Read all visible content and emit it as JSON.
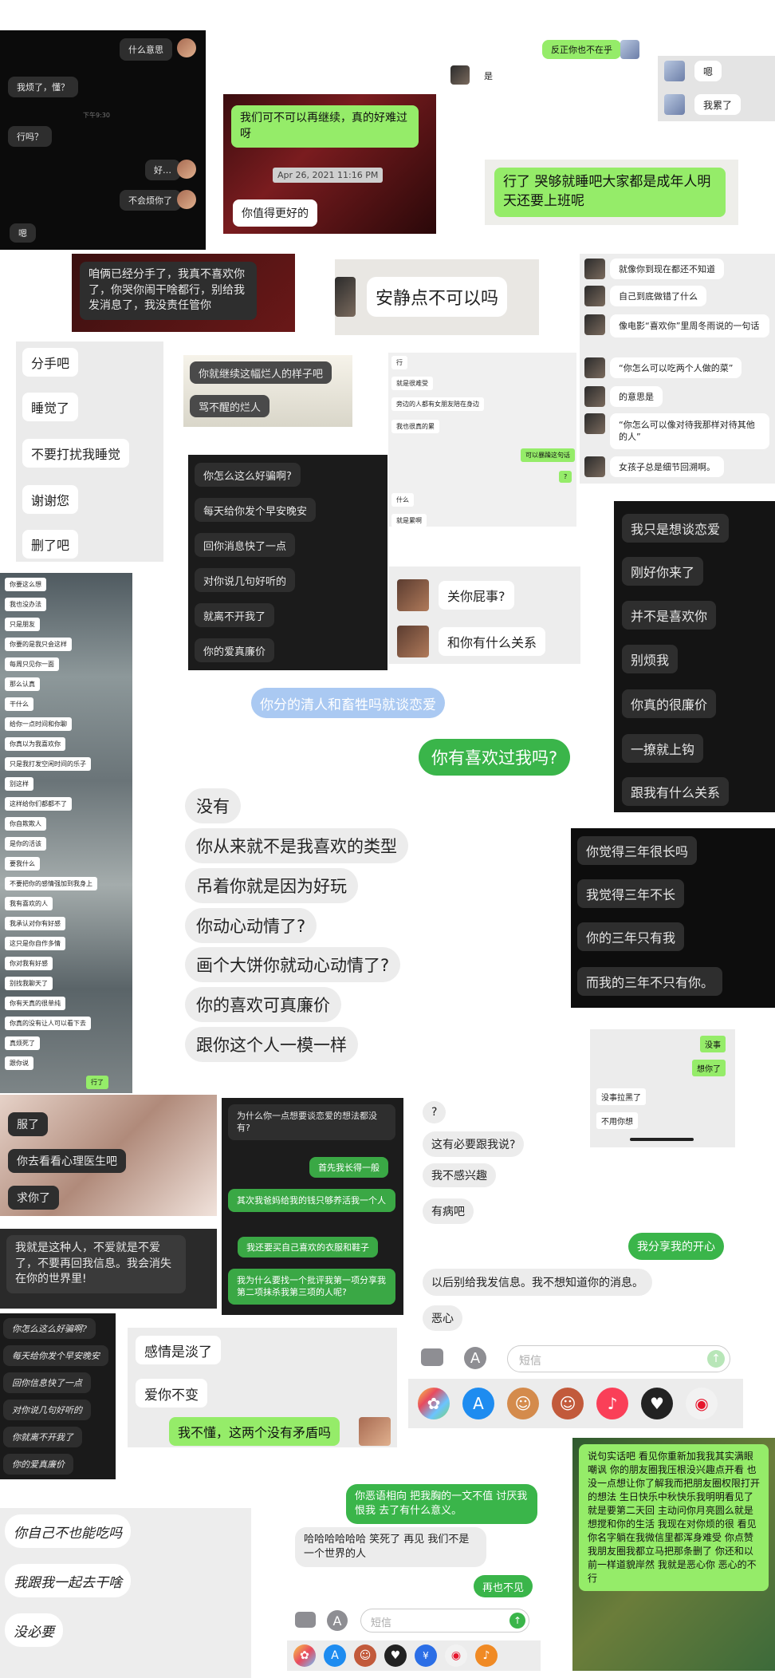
{
  "c1": {
    "b1": "什么意思",
    "b2": "我烦了，懂？",
    "time": "下午9:30",
    "b3": "行吗？",
    "b4": "好…",
    "b5": "不会烦你了",
    "b6": "嗯"
  },
  "c2": {
    "b1": "我们可不可以再继续，真的好难过呀",
    "date": "Apr 26, 2021 11:16 PM",
    "b2": "你值得更好的"
  },
  "c3": {
    "b1": "反正你也不在乎",
    "b2": "是"
  },
  "c4": {
    "b1": "嗯",
    "b2": "我累了"
  },
  "c5": {
    "b1": "行了 哭够就睡吧大家都是成年人明天还要上班呢"
  },
  "c6": {
    "b1": "咱俩已经分手了，我真不喜欢你了，你哭你闹干啥都行，别给我发消息了，我没责任管你"
  },
  "c7": {
    "b1": "安静点不可以吗"
  },
  "c8": {
    "items": [
      "就像你到现在都还不知道",
      "自己到底做错了什么",
      "像电影“喜欢你”里周冬雨说的一句话",
      "“你怎么可以吃两个人做的菜”",
      "的意思是",
      "“你怎么可以像对待我那样对待其他的人”",
      "女孩子总是细节回溯啊。"
    ]
  },
  "c9": {
    "items": [
      "分手吧",
      "睡觉了",
      "不要打扰我睡觉",
      "谢谢您",
      "删了吧"
    ]
  },
  "c10": {
    "b1": "你就继续这幅烂人的样子吧",
    "b2": "骂不醒的烂人"
  },
  "c11": {
    "b1": "行",
    "b2": "就是很难受",
    "b3": "旁边的人都有女朋友陪在身边",
    "b4": "我也很真的累",
    "b5": "可以暴躁这句话",
    "b6": "?",
    "b7": "什么",
    "b8": "就是累啊"
  },
  "c12": {
    "items": [
      "你怎么这么好骗啊?",
      "每天给你发个早安晚安",
      "回你消息快了一点",
      "对你说几句好听的",
      "就离不开我了",
      "你的爱真廉价"
    ]
  },
  "c13": {
    "b1": "关你屁事?",
    "b2": "和你有什么关系"
  },
  "c14": {
    "items": [
      "我只是想谈恋爱",
      "刚好你来了",
      "并不是喜欢你",
      "别烦我",
      "你真的很廉价",
      "一撩就上钩",
      "跟我有什么关系"
    ]
  },
  "c15": {
    "items": [
      "你要这么想",
      "我也没办法",
      "只是朋友",
      "你要的是我只会这样",
      "每周只见你一面",
      "那么认真",
      "干什么",
      "给你一点时间和你聊",
      "你真以为我喜欢你",
      "只是我打发空闲时间的乐子",
      "别这样",
      "这样给你们都都不了",
      "你自欺欺人",
      "是你的活该",
      "要我什么",
      "不要把你的感情强加到我身上",
      "我有喜欢的人",
      "我承认对你有好感",
      "这只是你自作多情",
      "你对我有好感",
      "别找我聊天了",
      "你有天真的很单纯",
      "你真的没有让人可以看下去",
      "真烦死了",
      "跟你说"
    ],
    "last": "行了"
  },
  "c16": {
    "b1": "你分的清人和畜牲吗就谈恋爱"
  },
  "c17": {
    "b1": "你有喜欢过我吗?"
  },
  "c18": {
    "items": [
      "没有",
      "你从来就不是我喜欢的类型",
      "吊着你就是因为好玩",
      "你动心动情了?",
      "画个大饼你就动心动情了?",
      "你的喜欢可真廉价",
      "跟你这个人一模一样"
    ]
  },
  "c19": {
    "items": [
      "你觉得三年很长吗",
      "我觉得三年不长",
      "你的三年只有我",
      "而我的三年不只有你。"
    ]
  },
  "c20": {
    "b1": "没事",
    "b2": "想你了",
    "b3": "没事拉黑了",
    "b4": "不用你想"
  },
  "c21": {
    "items": [
      "服了",
      "你去看看心理医生吧",
      "求你了"
    ]
  },
  "c22": {
    "b1": "为什么你一点想要谈恋爱的想法都没有?",
    "b2": "首先我长得一般",
    "b3": "其次我爸妈给我的钱只够养活我一个人",
    "b4": "我还要买自己喜欢的衣服和鞋子",
    "b5": "我为什么要找一个批评我第一项分享我第二项抹杀我第三项的人呢?"
  },
  "c23": {
    "b1": "?",
    "b2": "这有必要跟我说?",
    "b3": "我不感兴趣",
    "b4": "有病吧",
    "b5": "我分享我的开心",
    "b6": "以后别给我发信息。我不想知道你的消息。",
    "b7": "恶心",
    "placeholder": "短信"
  },
  "c24": {
    "b1": "我就是这种人，不爱就是不爱了，不要再回我信息。我会消失在你的世界里!"
  },
  "c25": {
    "items": [
      "你怎么这么好骗啊?",
      "每天给你发个早安晚安",
      "回你信息快了一点",
      "对你说几句好听的",
      "你就离不开我了",
      "你的爱真廉价"
    ]
  },
  "c26": {
    "b1": "感情是淡了",
    "b2": "爱你不变",
    "b3": "我不懂，这两个没有矛盾吗"
  },
  "c27": {
    "b1": "你自己不也能吃吗",
    "b2": "我跟我一起去干啥",
    "b3": "没必要"
  },
  "c28": {
    "b1": "你恶语相向 把我胸的一文不值 讨厌我 恨我 去了有什么意义。",
    "b2": "哈哈哈哈哈哈 笑死了 再见 我们不是一个世界的人",
    "b3": "再也不见",
    "placeholder": "短信"
  },
  "c29": {
    "b1": "说句实话吧 看见你重新加我我其实满眼嘲讽 你的朋友圈我压根没兴趣点开看 也没一点想让你了解我而把朋友圈权限打开的想法 生日快乐中秋快乐我明明看见了 就是要第二天回 主动问你月亮圆么就是想搅和你的生活 我现在对你烦的很 看见你名字躺在我微信里都浑身难受 你点赞我朋友圈我都立马把那条删了 你还和以前一样道貌岸然 我就是恶心你 恶心的不行"
  },
  "colors": {
    "wechat_green": "#95ec69",
    "imessage_green": "#3ab54a",
    "imessage_blue": "#aac9f2",
    "dark_bubble": "#2e2e2e",
    "light_bubble": "#ececec"
  },
  "icons": [
    "camera-icon",
    "appstore-icon",
    "send-icon",
    "photos-icon",
    "music-icon",
    "heart-icon",
    "weibo-icon",
    "memoji-icon"
  ]
}
